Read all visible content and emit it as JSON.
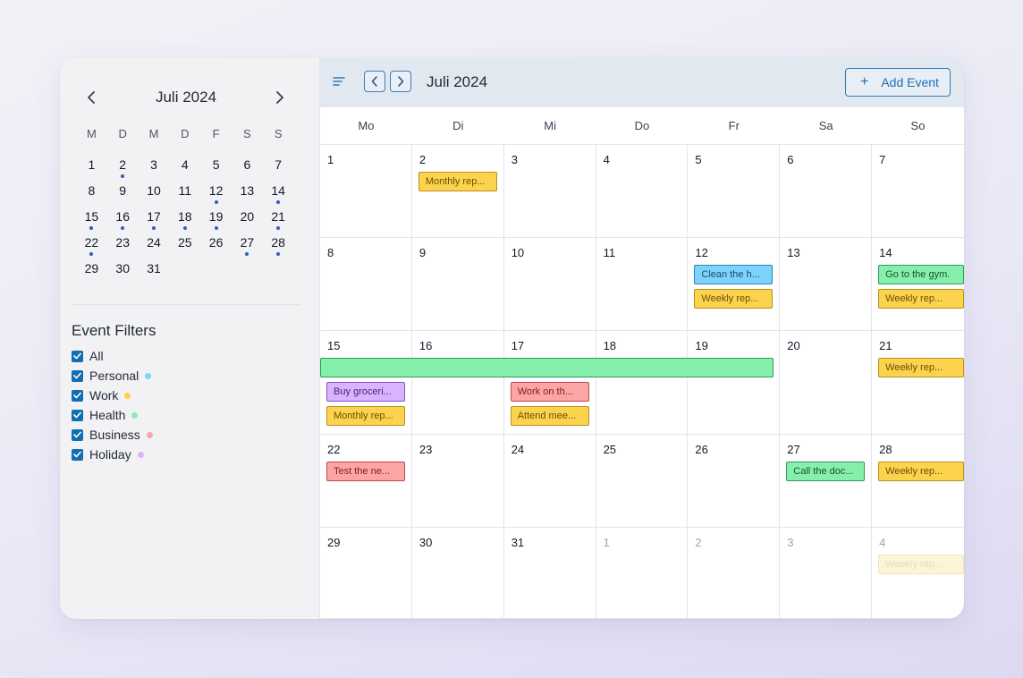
{
  "sidebar": {
    "month_label": "Juli 2024",
    "weekdays": [
      "M",
      "D",
      "M",
      "D",
      "F",
      "S",
      "S"
    ],
    "days": [
      {
        "label": "1",
        "dot": false
      },
      {
        "label": "2",
        "dot": true
      },
      {
        "label": "3",
        "dot": false
      },
      {
        "label": "4",
        "dot": false
      },
      {
        "label": "5",
        "dot": false
      },
      {
        "label": "6",
        "dot": false
      },
      {
        "label": "7",
        "dot": false
      },
      {
        "label": "8",
        "dot": false
      },
      {
        "label": "9",
        "dot": false
      },
      {
        "label": "10",
        "dot": false
      },
      {
        "label": "11",
        "dot": false
      },
      {
        "label": "12",
        "dot": true
      },
      {
        "label": "13",
        "dot": false
      },
      {
        "label": "14",
        "dot": true
      },
      {
        "label": "15",
        "dot": true
      },
      {
        "label": "16",
        "dot": true
      },
      {
        "label": "17",
        "dot": true
      },
      {
        "label": "18",
        "dot": true
      },
      {
        "label": "19",
        "dot": true
      },
      {
        "label": "20",
        "dot": false
      },
      {
        "label": "21",
        "dot": true
      },
      {
        "label": "22",
        "dot": true
      },
      {
        "label": "23",
        "dot": false
      },
      {
        "label": "24",
        "dot": false
      },
      {
        "label": "25",
        "dot": false
      },
      {
        "label": "26",
        "dot": false
      },
      {
        "label": "27",
        "dot": true
      },
      {
        "label": "28",
        "dot": true
      },
      {
        "label": "29",
        "dot": false
      },
      {
        "label": "30",
        "dot": false
      },
      {
        "label": "31",
        "dot": false
      }
    ],
    "filters_title": "Event Filters",
    "filters": [
      {
        "label": "All",
        "checked": true,
        "color": null
      },
      {
        "label": "Personal",
        "checked": true,
        "color": "#7dd3fc"
      },
      {
        "label": "Work",
        "checked": true,
        "color": "#fcd34d"
      },
      {
        "label": "Health",
        "checked": true,
        "color": "#86efac"
      },
      {
        "label": "Business",
        "checked": true,
        "color": "#fca5a5"
      },
      {
        "label": "Holiday",
        "checked": true,
        "color": "#d8b4fe"
      }
    ]
  },
  "toolbar": {
    "title": "Juli 2024",
    "add_event_label": "Add Event"
  },
  "calendar": {
    "weekdays": [
      "Mo",
      "Di",
      "Mi",
      "Do",
      "Fr",
      "Sa",
      "So"
    ],
    "weeks": [
      [
        "1",
        "2",
        "3",
        "4",
        "5",
        "6",
        "7"
      ],
      [
        "8",
        "9",
        "10",
        "11",
        "12",
        "13",
        "14"
      ],
      [
        "15",
        "16",
        "17",
        "18",
        "19",
        "20",
        "21"
      ],
      [
        "22",
        "23",
        "24",
        "25",
        "26",
        "27",
        "28"
      ],
      [
        "29",
        "30",
        "31",
        "1",
        "2",
        "3",
        "4"
      ]
    ],
    "next_month_days": [
      [
        4,
        3
      ],
      [
        4,
        4
      ],
      [
        4,
        5
      ],
      [
        4,
        6
      ]
    ],
    "events": [
      {
        "week": 0,
        "day": 1,
        "slot": 0,
        "span": 1,
        "title": "Monthly rep...",
        "category": "work"
      },
      {
        "week": 1,
        "day": 4,
        "slot": 0,
        "span": 1,
        "title": "Clean the h...",
        "category": "personal"
      },
      {
        "week": 1,
        "day": 4,
        "slot": 1,
        "span": 1,
        "title": "Weekly rep...",
        "category": "work"
      },
      {
        "week": 1,
        "day": 6,
        "slot": 0,
        "span": 1,
        "title": "Go to the gym.",
        "category": "health"
      },
      {
        "week": 1,
        "day": 6,
        "slot": 1,
        "span": 1,
        "title": "Weekly rep...",
        "category": "work"
      },
      {
        "week": 2,
        "day": 0,
        "slot": 0,
        "span": 5,
        "title": "",
        "category": "health"
      },
      {
        "week": 2,
        "day": 0,
        "slot": 1,
        "span": 1,
        "title": "Buy groceri...",
        "category": "holiday"
      },
      {
        "week": 2,
        "day": 0,
        "slot": 2,
        "span": 1,
        "title": "Monthly rep...",
        "category": "work"
      },
      {
        "week": 2,
        "day": 2,
        "slot": 1,
        "span": 1,
        "title": "Work on th...",
        "category": "business"
      },
      {
        "week": 2,
        "day": 2,
        "slot": 2,
        "span": 1,
        "title": "Attend mee...",
        "category": "work"
      },
      {
        "week": 2,
        "day": 6,
        "slot": 0,
        "span": 1,
        "title": "Weekly rep...",
        "category": "work"
      },
      {
        "week": 3,
        "day": 0,
        "slot": 0,
        "span": 1,
        "title": "Test the ne...",
        "category": "business"
      },
      {
        "week": 3,
        "day": 5,
        "slot": 0,
        "span": 1,
        "title": "Call the doc...",
        "category": "health"
      },
      {
        "week": 3,
        "day": 6,
        "slot": 0,
        "span": 1,
        "title": "Weekly rep...",
        "category": "work"
      },
      {
        "week": 4,
        "day": 6,
        "slot": 0,
        "span": 1,
        "title": "Weekly rep...",
        "category": "work",
        "faded": true
      }
    ]
  },
  "icons": {
    "mini_prev": "chevron-left-icon",
    "mini_next": "chevron-right-icon",
    "menu": "menu-icon",
    "add": "plus-icon",
    "check": "check-icon"
  },
  "colors": {
    "accent": "#0f6fb0",
    "topbar_bg": "#e2e8f0",
    "dot": "#2f5dc4"
  }
}
